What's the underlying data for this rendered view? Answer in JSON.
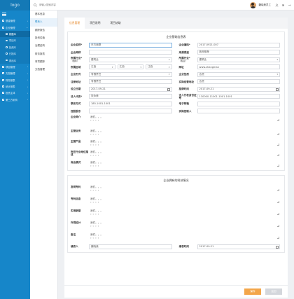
{
  "logo": "logo",
  "search": {
    "placeholder": "请输入搜索内容"
  },
  "user": {
    "name": "魏晓美员工"
  },
  "nav": {
    "items": [
      {
        "label": "基金管理"
      },
      {
        "label": "企业管理"
      }
    ],
    "sub_items": [
      {
        "label": "储备库"
      },
      {
        "label": "项目库"
      },
      {
        "label": "投资库"
      },
      {
        "label": "已投库"
      },
      {
        "label": "退出库"
      }
    ],
    "items_after": [
      {
        "label": "项目管理"
      },
      {
        "label": "文档管理"
      },
      {
        "label": "财务报表"
      },
      {
        "label": "统计报表"
      },
      {
        "label": "投资主体"
      },
      {
        "label": "第三方机构"
      }
    ]
  },
  "secondary_nav": {
    "items": [
      "基本信息",
      "联系人",
      "跟踪报告",
      "投资估值",
      "治理结构",
      "财务报表",
      "事项跟踪",
      "文档管理"
    ]
  },
  "tabs": [
    "信息管理",
    "项目说明",
    "项目协助"
  ],
  "section1": {
    "title": "企业基础信息表",
    "fields": {
      "company_name": {
        "label": "企业名称*",
        "value": "东方商联"
      },
      "company_no": {
        "label": "企业编码*",
        "value": "2017.0921.007"
      },
      "short_name": {
        "label": "企业简称",
        "value": ""
      },
      "source": {
        "label": "来源渠道",
        "value": "政府推荐"
      },
      "industry1": {
        "label": "所属行业*",
        "sublabel": "（国标）",
        "value": "建筑业"
      },
      "industry2": {
        "label": "所属行业*",
        "sublabel": "（私业）",
        "value": "建筑业"
      },
      "region": {
        "label": "所属区域",
        "values": [
          "江西",
          "江西",
          "江西"
        ]
      },
      "website": {
        "label": "网址",
        "value": "www.zhangman"
      },
      "company_type": {
        "label": "企业形式",
        "value": "有限责任"
      },
      "company_nature": {
        "label": "企业性质",
        "value": "合资"
      },
      "reg_address": {
        "label": "注册地址",
        "value": "有限责任"
      },
      "actual_address": {
        "label": "实际经营地址",
        "value": "合资"
      },
      "established": {
        "label": "设立日期",
        "value": "2017-09-21"
      },
      "listing_time": {
        "label": "挂牌时间",
        "value": "2017-09-21"
      },
      "legal_rep": {
        "label": "法人代表*",
        "value": "张永美"
      },
      "legal_id": {
        "label": "法人代表身份证号",
        "value": "130000-11001-1001-1001"
      },
      "phone": {
        "label": "联系方式",
        "value": "185-1001-1001"
      },
      "email": {
        "label": "电子邮箱",
        "value": ""
      },
      "controlling": {
        "label": "控股股东",
        "value": ""
      },
      "actual_controller": {
        "label": "实际控制人",
        "value": ""
      },
      "profile": {
        "label": "企业简介",
        "value": "我们。。。"
      },
      "main_business": {
        "label": "主营业务",
        "value": "我们。。。"
      },
      "main_product": {
        "label": "主营产品",
        "value": "我们。。。"
      },
      "position": {
        "label": "所在行业地位描述",
        "value": "我们。。。"
      },
      "profit_model": {
        "label": "商业模式",
        "value": "我们。。。"
      }
    }
  },
  "section2": {
    "title": "企业拥有的科技情况",
    "fields": {
      "patent": {
        "label": "发明专利",
        "value": "我们。。。"
      },
      "patent_info": {
        "label": "专利信息",
        "value": "我们。。。"
      },
      "utility": {
        "label": "实用新型",
        "value": "我们。。。"
      },
      "design": {
        "label": "外观设计",
        "value": "我们。。。"
      },
      "remark": {
        "label": "备注",
        "value": "我们。。。"
      },
      "filler": {
        "label": "填表人",
        "value": "魏晓美"
      },
      "fill_time": {
        "label": "填表时间",
        "value": "2017-09-21"
      }
    }
  },
  "buttons": {
    "save": "保存",
    "back": "返回"
  },
  "colors": {
    "sidebar": "#1686c9",
    "accent": "#f3a64a",
    "active_tab": "#e68a2e"
  }
}
